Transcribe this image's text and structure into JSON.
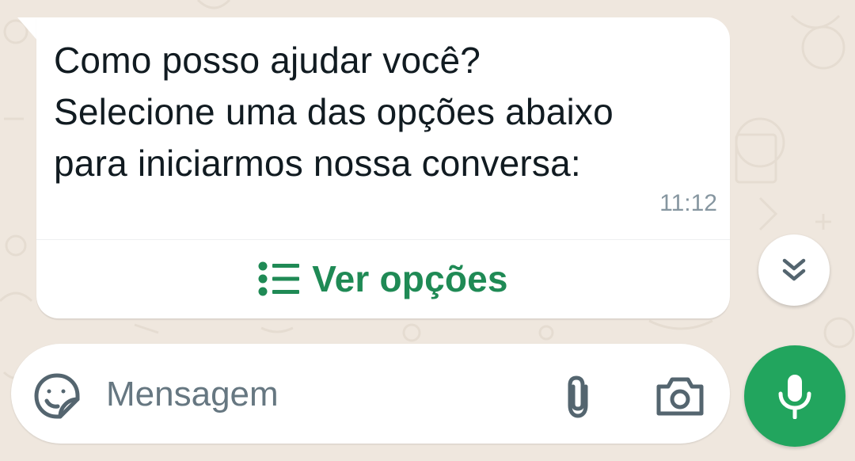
{
  "colors": {
    "chat_background": "#efe7de",
    "bubble_background": "#ffffff",
    "accent_green": "#1f8a55",
    "mic_button_green": "#22a55e",
    "timestamp_gray": "#8696a0",
    "icon_gray": "#54656f"
  },
  "message": {
    "lines": [
      "Como posso ajudar você?",
      "Selecione uma das opções abaixo",
      "para iniciarmos nossa conversa:"
    ],
    "time": "11:12",
    "options_button": {
      "label": "Ver opções",
      "icon": "list-icon"
    }
  },
  "scroll_down_button": {
    "icon": "double-chevron-down-icon"
  },
  "composer": {
    "placeholder": "Mensagem",
    "value": "",
    "left_icon": "sticker-icon",
    "right_icons": [
      "attachment-icon",
      "camera-icon"
    ]
  },
  "mic_button": {
    "icon": "microphone-icon"
  }
}
